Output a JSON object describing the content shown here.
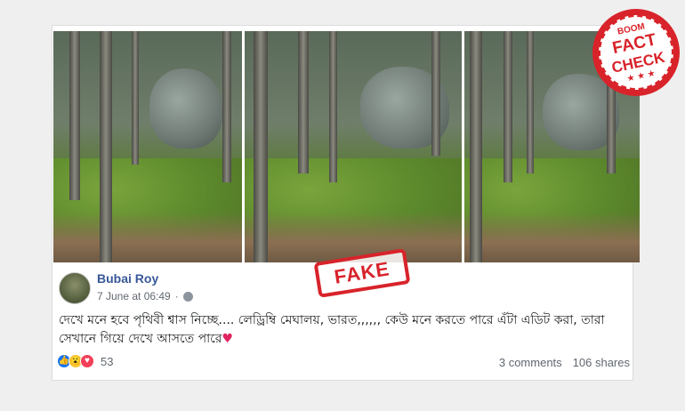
{
  "post": {
    "author": "Bubai Roy",
    "timestamp": "7 June at 06:49",
    "text": "দেখে মনে হবে পৃথিবী শ্বাস নিচ্ছে.... লেড্রিম্বি মেঘালয়, ভারত,,,,,, কেউ মনে করতে পারে এঁটা এডিট করা, তারা সেখানে গিয়ে দেখে আসতে পারে",
    "heart": "♥"
  },
  "reactions": {
    "count": "53",
    "like_glyph": "👍",
    "wow_glyph": "😮",
    "love_glyph": "♥"
  },
  "stats": {
    "comments": "3 comments",
    "shares": "106 shares"
  },
  "stamp": {
    "label": "FAKE"
  },
  "badge": {
    "brand": "BOOM",
    "line1": "FACT",
    "line2": "CHECK",
    "stars": "★ ★ ★"
  },
  "colors": {
    "link": "#385898",
    "stamp_red": "#d8232a",
    "like_blue": "#1877f2"
  }
}
